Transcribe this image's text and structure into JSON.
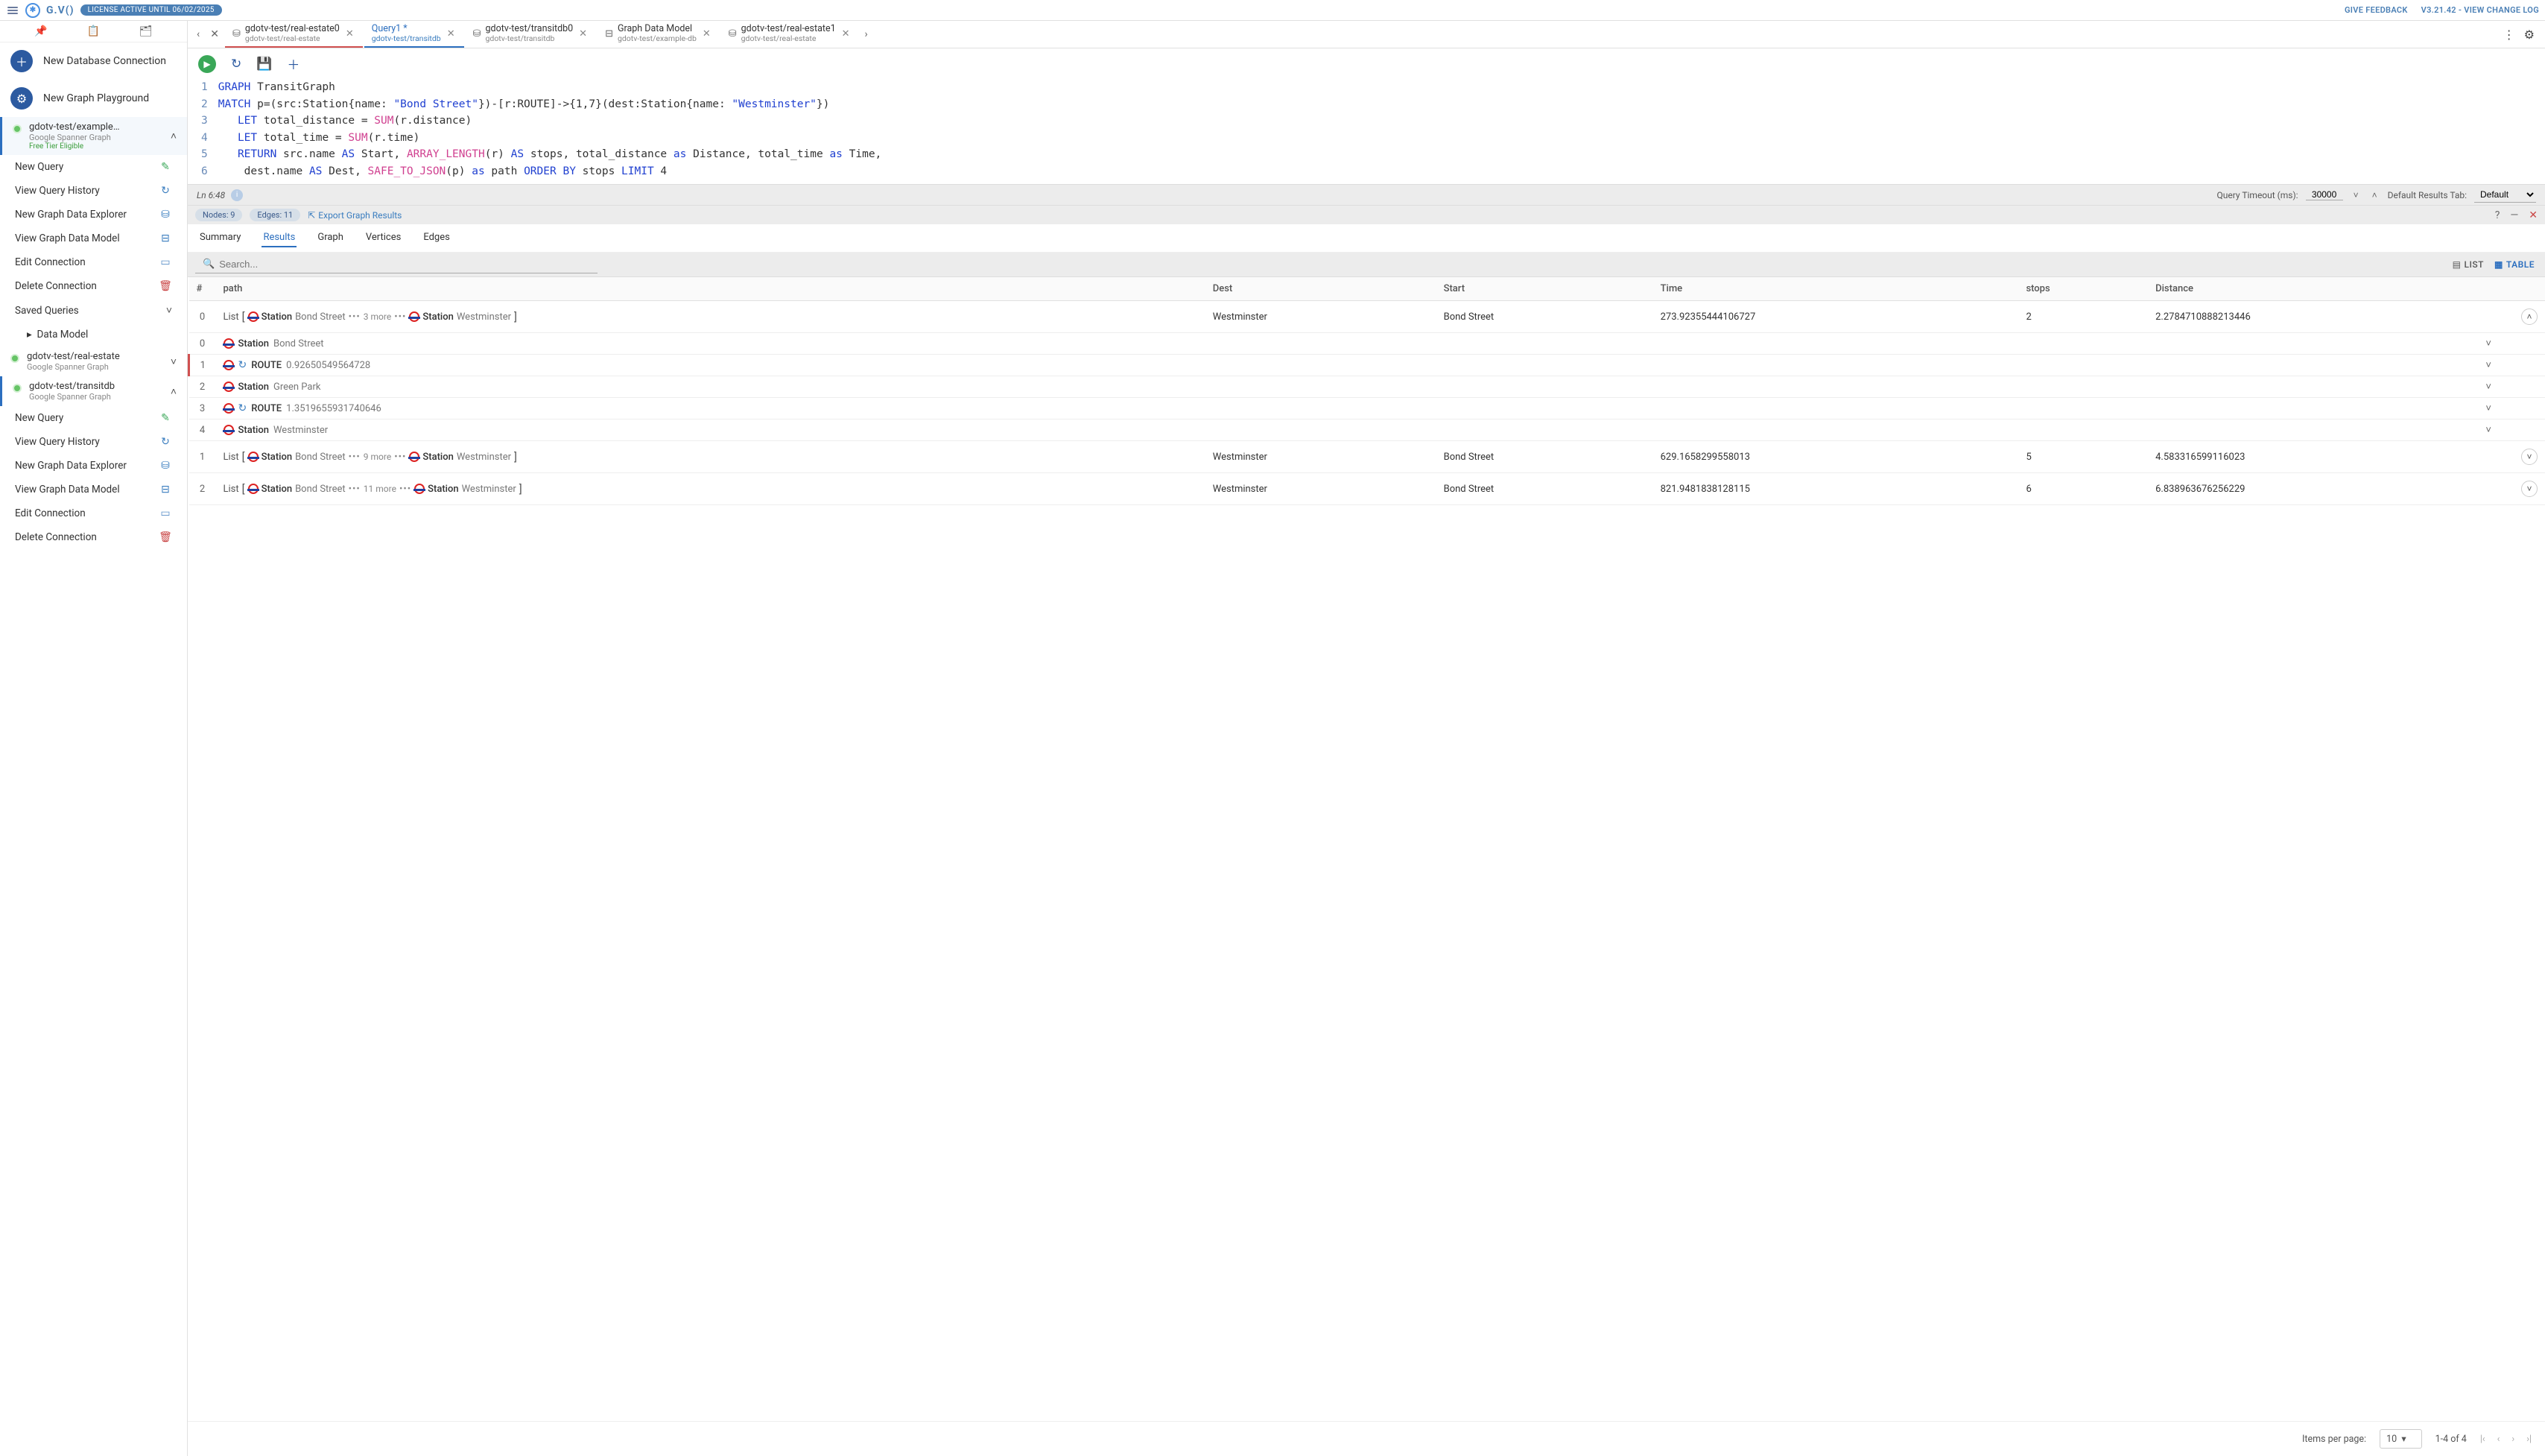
{
  "topbar": {
    "logo_text": "G.V()",
    "license": "LICENSE ACTIVE UNTIL 06/02/2025",
    "feedback": "GIVE FEEDBACK",
    "version": "V3.21.42 - VIEW CHANGE LOG"
  },
  "sidebar": {
    "new_db": "New Database Connection",
    "new_pg": "New Graph Playground",
    "connections": [
      {
        "title": "gdotv-test/example…",
        "sub": "Google Spanner Graph",
        "free": "Free Tier Eligible",
        "expanded": true,
        "hl": true
      },
      {
        "title": "gdotv-test/real-estate",
        "sub": "Google Spanner Graph",
        "expanded": false
      },
      {
        "title": "gdotv-test/transitdb",
        "sub": "Google Spanner Graph",
        "expanded": true
      }
    ],
    "actions": {
      "new_query": "New Query",
      "view_history": "View Query History",
      "new_explorer": "New Graph Data Explorer",
      "view_model": "View Graph Data Model",
      "edit_conn": "Edit Connection",
      "delete_conn": "Delete Connection",
      "saved_queries": "Saved Queries",
      "data_model": "Data Model"
    }
  },
  "tabs": [
    {
      "title": "gdotv-test/real-estate0",
      "sub": "gdotv-test/real-estate",
      "icon": "db",
      "dirty": true
    },
    {
      "title": "Query1 *",
      "sub": "gdotv-test/transitdb",
      "icon": "db",
      "active": true
    },
    {
      "title": "gdotv-test/transitdb0",
      "sub": "gdotv-test/transitdb",
      "icon": "db"
    },
    {
      "title": "Graph Data Model",
      "sub": "gdotv-test/example-db",
      "icon": "model"
    },
    {
      "title": "gdotv-test/real-estate1",
      "sub": "gdotv-test/real-estate",
      "icon": "db"
    }
  ],
  "editor": {
    "lines": [
      "GRAPH TransitGraph",
      "MATCH p=(src:Station{name: \"Bond Street\"})-[r:ROUTE]->{1,7}(dest:Station{name: \"Westminster\"})",
      "   LET total_distance = SUM(r.distance)",
      "   LET total_time = SUM(r.time)",
      "   RETURN src.name AS Start, ARRAY_LENGTH(r) AS stops, total_distance as Distance, total_time as Time,",
      "    dest.name AS Dest, SAFE_TO_JSON(p) as path ORDER BY stops LIMIT 4"
    ],
    "cursor": "Ln 6:48"
  },
  "status": {
    "timeout_label": "Query Timeout (ms):",
    "timeout_value": "30000",
    "default_tab_label": "Default Results Tab:",
    "default_tab_value": "Default"
  },
  "results_meta": {
    "nodes": "Nodes: 9",
    "edges": "Edges: 11",
    "export": "Export Graph Results"
  },
  "result_tabs": [
    "Summary",
    "Results",
    "Graph",
    "Vertices",
    "Edges"
  ],
  "result_tab_active": "Results",
  "search_placeholder": "Search...",
  "view_list": "LIST",
  "view_table": "TABLE",
  "columns": [
    "#",
    "path",
    "Dest",
    "Start",
    "Time",
    "stops",
    "Distance"
  ],
  "rows": [
    {
      "idx": "0",
      "more": "3 more",
      "dest": "Westminster",
      "start": "Bond Street",
      "time": "273.92355444106727",
      "stops": "2",
      "distance": "2.2784710888213446",
      "expanded": true
    },
    {
      "idx": "1",
      "more": "9 more",
      "dest": "Westminster",
      "start": "Bond Street",
      "time": "629.1658299558013",
      "stops": "5",
      "distance": "4.583316599116023"
    },
    {
      "idx": "2",
      "more": "11 more",
      "dest": "Westminster",
      "start": "Bond Street",
      "time": "821.9481838128115",
      "stops": "6",
      "distance": "6.838963676256229"
    }
  ],
  "sub_rows": [
    {
      "idx": "0",
      "type": "Station",
      "label": "Bond Street"
    },
    {
      "idx": "1",
      "type": "ROUTE",
      "label": "0.92650549564728",
      "edge": true,
      "hl": true
    },
    {
      "idx": "2",
      "type": "Station",
      "label": "Green Park"
    },
    {
      "idx": "3",
      "type": "ROUTE",
      "label": "1.3519655931740646",
      "edge": true
    },
    {
      "idx": "4",
      "type": "Station",
      "label": "Westminster"
    }
  ],
  "path_station_label": "Station",
  "list_label": "List",
  "pagination": {
    "items_per_page_label": "Items per page:",
    "items_per_page": "10",
    "range": "1-4 of 4"
  }
}
